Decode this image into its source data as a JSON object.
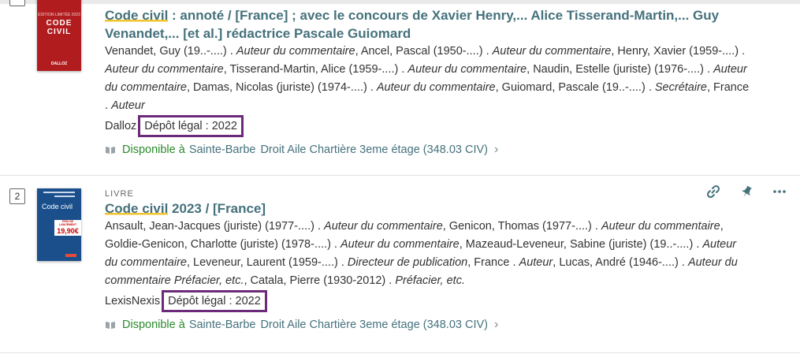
{
  "results": [
    {
      "title_highlight": "Code civil",
      "title_rest": " : annoté / [France] ; avec le concours de Xavier Henry,... Alice Tisserand-Martin,... Guy Venandet,... [et al.] rédactrice Pascale Guiomard",
      "authors": [
        {
          "text": "Venandet, Guy (19..-....) . ",
          "role": "Auteur du commentaire"
        },
        {
          "text": ", Ancel, Pascal (1950-....) . ",
          "role": "Auteur du commentaire"
        },
        {
          "text": ", Henry, Xavier (1959-....) . ",
          "role": "Auteur du commentaire"
        },
        {
          "text": ", Tisserand-Martin, Alice (1959-....) . ",
          "role": "Auteur du commentaire"
        },
        {
          "text": ", Naudin, Estelle (juriste) (1976-....) . ",
          "role": "Auteur du commentaire"
        },
        {
          "text": ", Damas, Nicolas (juriste) (1974-....) . ",
          "role": "Auteur du commentaire"
        },
        {
          "text": ", Guiomard, Pascale (19..-....) . ",
          "role": "Secrétaire"
        },
        {
          "text": ", France . ",
          "role": "Auteur"
        }
      ],
      "publisher": "Dalloz",
      "depot_legal": "Dépôt légal : 2022",
      "availability": {
        "status": "Disponible à",
        "library": "Sainte-Barbe",
        "shelf": "Droit Aile Chartière 3eme étage (348.03 CIV)"
      },
      "cover": {
        "label": "CODE CIVIL",
        "publisher_mark": "DALLOZ"
      }
    },
    {
      "number": "2",
      "type": "LIVRE",
      "title_highlight": "Code civil",
      "title_rest": " 2023 / [France]",
      "authors": [
        {
          "text": "Ansault, Jean-Jacques (juriste) (1977-....) . ",
          "role": "Auteur du commentaire"
        },
        {
          "text": ", Genicon, Thomas (1977-....) . ",
          "role": "Auteur du commentaire"
        },
        {
          "text": ", Goldie-Genicon, Charlotte (juriste) (1978-....) . ",
          "role": "Auteur du commentaire"
        },
        {
          "text": ", Mazeaud-Leveneur, Sabine (juriste) (19..-....) . ",
          "role": "Auteur du commentaire"
        },
        {
          "text": ", Leveneur, Laurent (1959-....) . ",
          "role": "Directeur de publication"
        },
        {
          "text": ", France . ",
          "role": "Auteur"
        },
        {
          "text": ", Lucas, André (1946-....) . ",
          "role": "Auteur du commentaire Préfacier, etc."
        },
        {
          "text": ", Catala, Pierre (1930-2012) . ",
          "role": "Préfacier, etc."
        }
      ],
      "publisher": "LexisNexis",
      "depot_legal": "Dépôt légal : 2022",
      "availability": {
        "status": "Disponible à",
        "library": "Sainte-Barbe",
        "shelf": "Droit Aile Chartière 3eme étage (348.03 CIV)"
      },
      "cover": {
        "label": "Code civil",
        "price_line1": "PRIX DE LANCEMENT",
        "price": "19,90€"
      }
    }
  ],
  "colors": {
    "link": "#45717c",
    "available": "#2a8a2a",
    "highlight": "#f2c530",
    "depot_box": "#6b2a7a"
  },
  "icons": {
    "actions": [
      "link-icon",
      "pin-icon",
      "more-icon"
    ],
    "availability": "book-open-icon",
    "chevron": "chevron-right-icon"
  }
}
